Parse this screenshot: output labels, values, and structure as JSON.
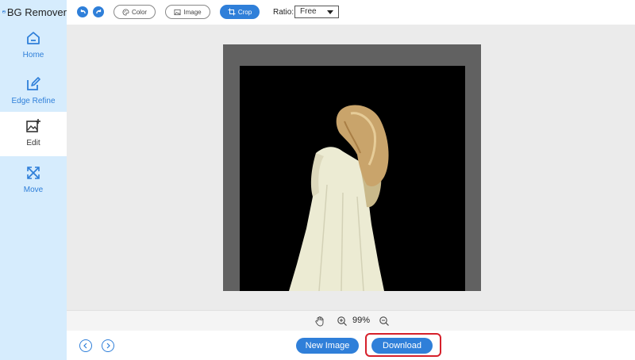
{
  "app": {
    "title": "BG Remover"
  },
  "sidebar": {
    "items": [
      {
        "label": "Home",
        "icon": "home-icon"
      },
      {
        "label": "Edge Refine",
        "icon": "edit-pen-icon"
      },
      {
        "label": "Edit",
        "icon": "image-edit-icon",
        "active": true
      },
      {
        "label": "Move",
        "icon": "move-arrows-icon"
      }
    ]
  },
  "toolbar": {
    "undo_icon": "undo-icon",
    "redo_icon": "redo-icon",
    "color_label": "Color",
    "image_label": "Image",
    "crop_label": "Crop",
    "ratio_label": "Ratio:",
    "ratio_value": "Free"
  },
  "zoom": {
    "value": "99%"
  },
  "footer": {
    "new_image_label": "New Image",
    "download_label": "Download"
  },
  "colors": {
    "accent": "#2f7fd9",
    "sidebar_bg": "#d6ecfd",
    "highlight": "#d6202b"
  }
}
